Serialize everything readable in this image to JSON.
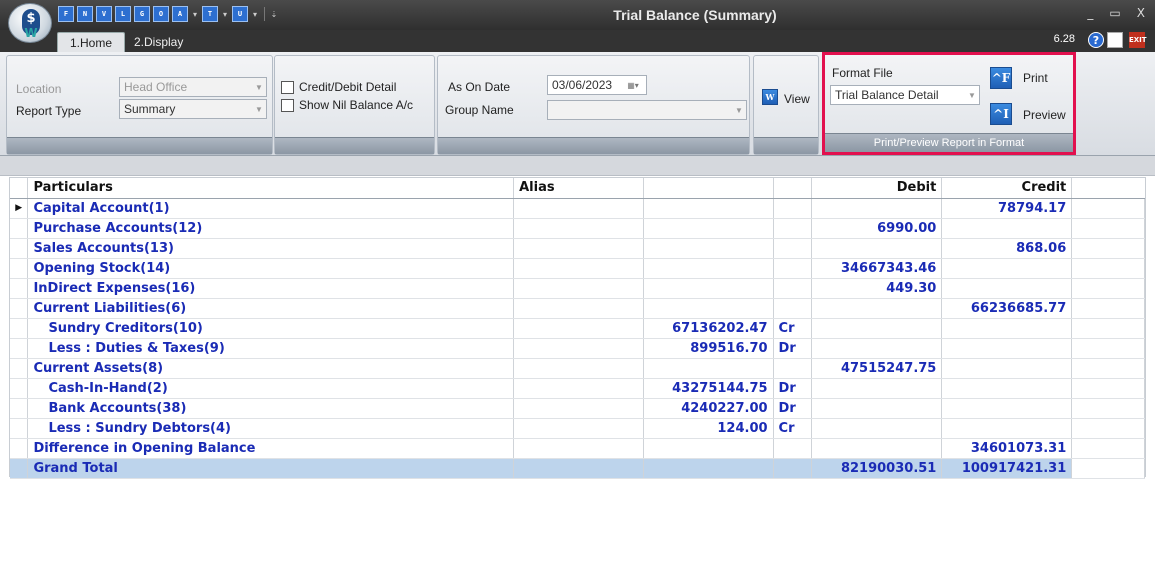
{
  "window": {
    "title": "Trial Balance (Summary)",
    "controls": [
      "_",
      "▭",
      "X"
    ],
    "quick_access": [
      "F",
      "N",
      "V",
      "L",
      "G",
      "O",
      "A",
      "T",
      "U"
    ]
  },
  "tabs": [
    {
      "label": "1.Home"
    },
    {
      "label": "2.Display"
    }
  ],
  "version": "6.28",
  "ribbon": {
    "location_label": "Location",
    "location_value": "Head Office",
    "report_type_label": "Report Type",
    "report_type_value": "Summary",
    "credit_debit_detail": "Credit/Debit Detail",
    "show_nil_balance": "Show Nil Balance A/c",
    "as_on_date_label": "As On Date",
    "as_on_date_value": "03/06/2023",
    "group_name_label": "Group Name",
    "group_name_value": "",
    "view_label": "View",
    "format_file_label": "Format File",
    "format_file_value": "Trial Balance Detail",
    "print_label": "Print",
    "preview_label": "Preview",
    "format_group_caption": "Print/Preview Report in Format",
    "print_icon_text": "^F",
    "preview_icon_text": "^I"
  },
  "grid": {
    "columns": [
      "Particulars",
      "Alias",
      "",
      "",
      "Debit",
      "Credit"
    ],
    "rows": [
      {
        "particulars": "Capital Account(1)",
        "alias": "",
        "amount": "",
        "drcr": "",
        "debit": "",
        "credit": "78794.17"
      },
      {
        "particulars": "Purchase Accounts(12)",
        "alias": "",
        "amount": "",
        "drcr": "",
        "debit": "6990.00",
        "credit": ""
      },
      {
        "particulars": "Sales Accounts(13)",
        "alias": "",
        "amount": "",
        "drcr": "",
        "debit": "",
        "credit": "868.06"
      },
      {
        "particulars": "Opening Stock(14)",
        "alias": "",
        "amount": "",
        "drcr": "",
        "debit": "34667343.46",
        "credit": ""
      },
      {
        "particulars": "InDirect Expenses(16)",
        "alias": "",
        "amount": "",
        "drcr": "",
        "debit": "449.30",
        "credit": ""
      },
      {
        "particulars": "Current Liabilities(6)",
        "alias": "",
        "amount": "",
        "drcr": "",
        "debit": "",
        "credit": "66236685.77"
      },
      {
        "particulars": "Sundry Creditors(10)",
        "alias": "",
        "amount": "67136202.47",
        "drcr": "Cr",
        "debit": "",
        "credit": ""
      },
      {
        "particulars": "Less : Duties & Taxes(9)",
        "alias": "",
        "amount": "899516.70",
        "drcr": "Dr",
        "debit": "",
        "credit": ""
      },
      {
        "particulars": "Current Assets(8)",
        "alias": "",
        "amount": "",
        "drcr": "",
        "debit": "47515247.75",
        "credit": ""
      },
      {
        "particulars": "Cash-In-Hand(2)",
        "alias": "",
        "amount": "43275144.75",
        "drcr": "Dr",
        "debit": "",
        "credit": ""
      },
      {
        "particulars": "Bank Accounts(38)",
        "alias": "",
        "amount": "4240227.00",
        "drcr": "Dr",
        "debit": "",
        "credit": ""
      },
      {
        "particulars": "Less : Sundry Debtors(4)",
        "alias": "",
        "amount": "124.00",
        "drcr": "Cr",
        "debit": "",
        "credit": ""
      },
      {
        "particulars": "Difference in Opening Balance",
        "alias": "",
        "amount": "",
        "drcr": "",
        "debit": "",
        "credit": "34601073.31"
      }
    ],
    "total": {
      "particulars": "Grand Total",
      "debit": "82190030.51",
      "credit": "100917421.31"
    }
  }
}
